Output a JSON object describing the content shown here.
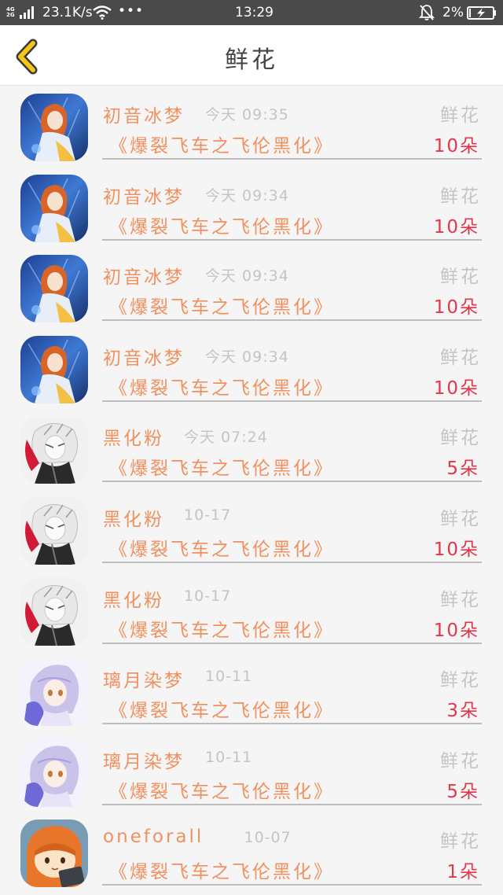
{
  "status_bar": {
    "network": "4G/2G",
    "speed": "23.1K/s",
    "more": "•••",
    "time": "13:29",
    "battery_pct": "2%",
    "icons": [
      "signal-icon",
      "wifi-icon",
      "mute-icon",
      "battery-charging-icon"
    ]
  },
  "nav": {
    "back_icon": "chevron-left-icon",
    "title": "鲜花"
  },
  "colors": {
    "accent": "#f0915f",
    "count": "#e2364a",
    "muted": "#c4c4c4",
    "back_chevron": "#f5c518"
  },
  "records": [
    {
      "user": "初音冰梦",
      "time": "今天 09:35",
      "type": "鲜花",
      "work": "《爆裂飞车之飞伦黑化》",
      "count": "10朵",
      "avatar": "avatar-anime-blue"
    },
    {
      "user": "初音冰梦",
      "time": "今天 09:34",
      "type": "鲜花",
      "work": "《爆裂飞车之飞伦黑化》",
      "count": "10朵",
      "avatar": "avatar-anime-blue"
    },
    {
      "user": "初音冰梦",
      "time": "今天 09:34",
      "type": "鲜花",
      "work": "《爆裂飞车之飞伦黑化》",
      "count": "10朵",
      "avatar": "avatar-anime-blue"
    },
    {
      "user": "初音冰梦",
      "time": "今天 09:34",
      "type": "鲜花",
      "work": "《爆裂飞车之飞伦黑化》",
      "count": "10朵",
      "avatar": "avatar-anime-blue"
    },
    {
      "user": "黑化粉",
      "time": "今天 07:24",
      "type": "鲜花",
      "work": "《爆裂飞车之飞伦黑化》",
      "count": "5朵",
      "avatar": "avatar-anime-white"
    },
    {
      "user": "黑化粉",
      "time": "10-17",
      "type": "鲜花",
      "work": "《爆裂飞车之飞伦黑化》",
      "count": "10朵",
      "avatar": "avatar-anime-white"
    },
    {
      "user": "黑化粉",
      "time": "10-17",
      "type": "鲜花",
      "work": "《爆裂飞车之飞伦黑化》",
      "count": "10朵",
      "avatar": "avatar-anime-white"
    },
    {
      "user": "璃月染梦",
      "time": "10-11",
      "type": "鲜花",
      "work": "《爆裂飞车之飞伦黑化》",
      "count": "3朵",
      "avatar": "avatar-anime-lavender"
    },
    {
      "user": "璃月染梦",
      "time": "10-11",
      "type": "鲜花",
      "work": "《爆裂飞车之飞伦黑化》",
      "count": "5朵",
      "avatar": "avatar-anime-lavender"
    },
    {
      "user": "oneforall",
      "time": "10-07",
      "type": "鲜花",
      "work": "《爆裂飞车之飞伦黑化》",
      "count": "1朵",
      "avatar": "avatar-anime-orange"
    }
  ]
}
